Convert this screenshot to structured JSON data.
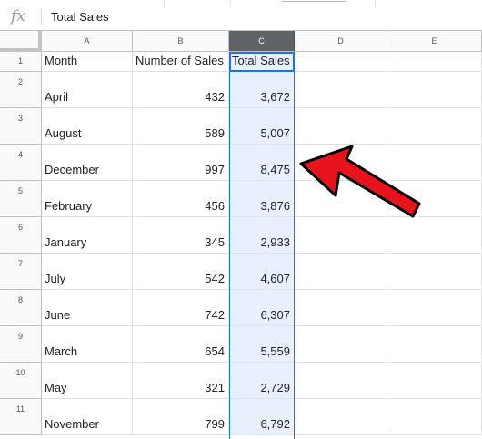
{
  "formula_bar": {
    "fx_icon": "fx",
    "content": "Total Sales"
  },
  "columns": [
    {
      "label": "A"
    },
    {
      "label": "B"
    },
    {
      "label": "C",
      "selected": true
    },
    {
      "label": "D"
    },
    {
      "label": "E"
    }
  ],
  "rows": [
    {
      "num": "1",
      "month": "Month",
      "sales": "Number of Sales",
      "total": "Total Sales"
    },
    {
      "num": "2",
      "month": "April",
      "sales": "432",
      "total": "3,672"
    },
    {
      "num": "3",
      "month": "August",
      "sales": "589",
      "total": "5,007"
    },
    {
      "num": "4",
      "month": "December",
      "sales": "997",
      "total": "8,475"
    },
    {
      "num": "5",
      "month": "February",
      "sales": "456",
      "total": "3,876"
    },
    {
      "num": "6",
      "month": "January",
      "sales": "345",
      "total": "2,933"
    },
    {
      "num": "7",
      "month": "July",
      "sales": "542",
      "total": "4,607"
    },
    {
      "num": "8",
      "month": "June",
      "sales": "742",
      "total": "6,307"
    },
    {
      "num": "9",
      "month": "March",
      "sales": "654",
      "total": "5,559"
    },
    {
      "num": "10",
      "month": "May",
      "sales": "321",
      "total": "2,729"
    },
    {
      "num": "11",
      "month": "November",
      "sales": "799",
      "total": "6,792"
    }
  ],
  "colors": {
    "selected_column_header": "#5f6368",
    "selection_fill": "#e8f0fe",
    "selection_border": "#1a73e8",
    "annotation_arrow": "#e8141c"
  }
}
